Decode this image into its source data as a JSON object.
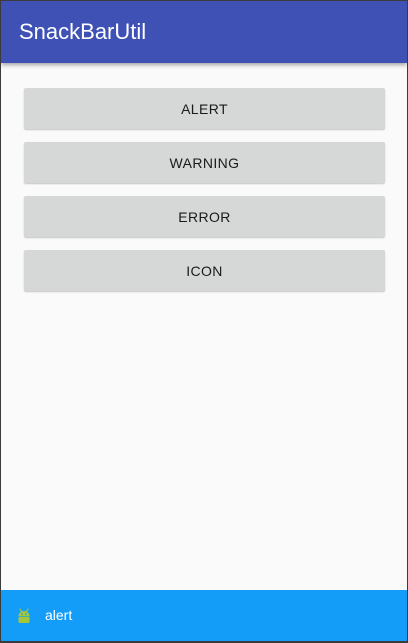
{
  "app_bar": {
    "title": "SnackBarUtil",
    "color": "#3f51b5"
  },
  "buttons": [
    {
      "label": "ALERT"
    },
    {
      "label": "WARNING"
    },
    {
      "label": "ERROR"
    },
    {
      "label": "ICON"
    }
  ],
  "snackbar": {
    "icon": "android-icon",
    "message": "alert",
    "background": "#139cf8"
  }
}
